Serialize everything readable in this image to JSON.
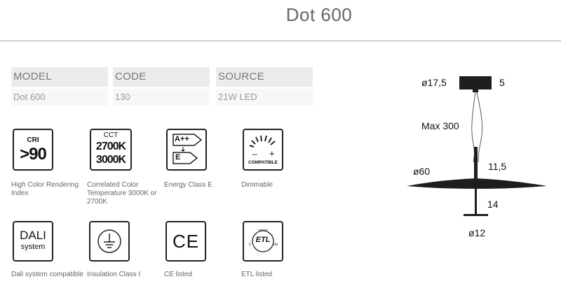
{
  "title": "Dot 600",
  "specs": [
    {
      "header": "MODEL",
      "value": "Dot 600"
    },
    {
      "header": "CODE",
      "value": "130"
    },
    {
      "header": "SOURCE",
      "value": "21W LED"
    }
  ],
  "icons": {
    "cri": {
      "label": "CRI",
      "value": ">90",
      "caption": "High Color Rendering Index"
    },
    "cct": {
      "label": "CCT",
      "line1": "2700K",
      "line2": "3000K",
      "caption": "Correlated Color Temperature 3000K or 2700K"
    },
    "energy": {
      "top": "A++",
      "bottom": "E",
      "caption": "Energy Class E"
    },
    "dimmable": {
      "minus": "–",
      "plus": "+",
      "text": "COMPATIBLE",
      "caption": "Dimmable"
    },
    "dali": {
      "line1": "DALI",
      "line2": "system",
      "caption": "Dali system compatible"
    },
    "insulation": {
      "caption": "Insulation Class I"
    },
    "ce": {
      "mark": "CE",
      "caption": "CE listed"
    },
    "etl": {
      "mark": "ETL",
      "c": "c",
      "us": "us",
      "intertek": "Intertek",
      "caption": "ETL listed"
    }
  },
  "drawing": {
    "canopy_diameter": "ø17,5",
    "canopy_height": "5",
    "cable_length": "Max 300",
    "shade_diameter": "ø60",
    "shade_height": "11,5",
    "lower_height": "14",
    "base_diameter": "ø12"
  },
  "colors": {
    "icon_stroke": "#222222",
    "header_bg": "#ececec",
    "value_bg": "#f7f7f7"
  }
}
